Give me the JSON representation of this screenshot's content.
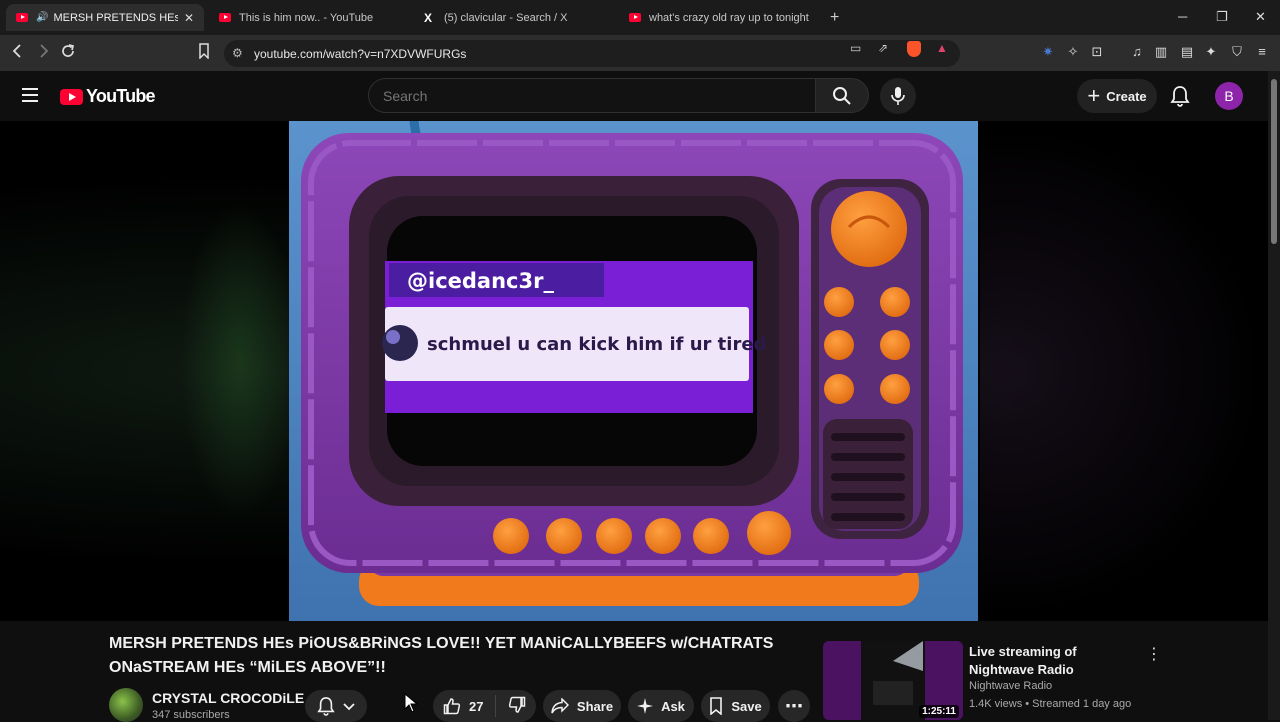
{
  "browser": {
    "tabs": [
      {
        "title": "MERSH PRETENDS HEs PiOUS",
        "icon": "youtube-icon",
        "active": true
      },
      {
        "title": "This is him now.. - YouTube",
        "icon": "youtube-icon",
        "active": false
      },
      {
        "title": "(5) clavicular - Search / X",
        "icon": "x-icon",
        "active": false
      },
      {
        "title": "what's crazy old ray up to tonight? (g",
        "icon": "youtube-icon",
        "active": false
      }
    ],
    "url": "youtube.com/watch?v=n7XDVWFURGs",
    "new_tab_glyph": "+",
    "brave_badge": "10"
  },
  "youtube": {
    "logo_text": "YouTube",
    "search_placeholder": "Search",
    "create_label": "Create",
    "avatar_letter": "B",
    "brand_red": "#ff0033"
  },
  "video": {
    "overlay_username": "@icedanc3r_",
    "overlay_message": "schmuel u can kick him if ur tired",
    "title": "MERSH PRETENDS HEs PiOUS&BRiNGS LOVE!! YET MANiCALLYBEEFS w/CHATRATS ONaSTREAM HEs “MiLES ABOVE”!!",
    "channel_name": "CRYSTAL CROCODiLE",
    "subscribers": "347 subscribers",
    "likes": "27",
    "share_label": "Share",
    "ask_label": "Ask",
    "save_label": "Save"
  },
  "sidebar": {
    "item": {
      "title": "Live streaming of Nightwave Radio",
      "channel": "Nightwave Radio",
      "meta": "1.4K views • Streamed 1 day ago",
      "duration": "1:25:11"
    }
  }
}
